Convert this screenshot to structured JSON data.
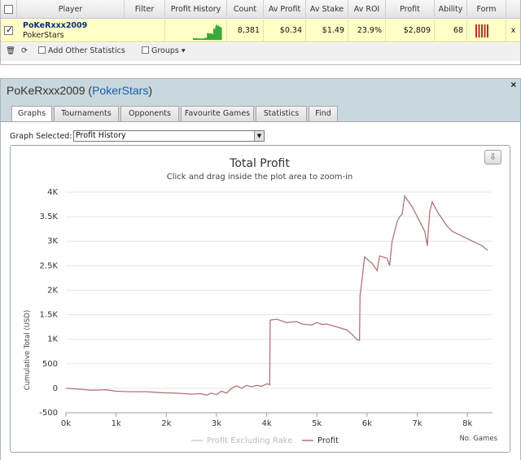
{
  "grid": {
    "columns": [
      "Player",
      "Filter",
      "Profit History",
      "Count",
      "Av Profit",
      "Av Stake",
      "Av ROI",
      "Profit",
      "Ability",
      "Form"
    ],
    "row": {
      "player_name": "PoKeRxxx2009",
      "site": "PokerStars",
      "count": "8,381",
      "av_profit": "$0.34",
      "av_stake": "$1.49",
      "av_roi": "23.9%",
      "profit": "$2,809",
      "ability": "68",
      "remove": "x"
    },
    "sparkline_color": "#3aa83a",
    "form_color": "#b03030",
    "toolbar": {
      "add_stats": "Add Other Statistics",
      "groups": "Groups"
    }
  },
  "panel": {
    "player_name": "PoKeRxxx2009",
    "site": "PokerStars",
    "close": "×",
    "tabs": [
      "Graphs",
      "Tournaments",
      "Opponents",
      "Favourite Games",
      "Statistics",
      "Find"
    ],
    "active_tab": 0,
    "graph_selected_label": "Graph Selected:",
    "graph_selected_value": "Profit History",
    "download_icon": "download-icon"
  },
  "chart_data": {
    "type": "line",
    "title": "Total Profit",
    "subtitle": "Click and drag inside the plot area to zoom-in",
    "xlabel": "No. Games",
    "ylabel": "Cumulative Total (USD)",
    "xlim": [
      0,
      8500
    ],
    "ylim": [
      -500,
      4000
    ],
    "x_ticks": [
      "0k",
      "1k",
      "2k",
      "3k",
      "4k",
      "5k",
      "6k",
      "7k",
      "8k"
    ],
    "y_ticks": [
      "-500",
      "0",
      "500",
      "1K",
      "1.5K",
      "2K",
      "2.5K",
      "3K",
      "3.5K",
      "4K"
    ],
    "legend": [
      "Profit Excluding Rake",
      "Profit"
    ],
    "legend_colors": [
      "#cccccc",
      "#b07575"
    ],
    "line_color": "#b07575",
    "series": [
      {
        "name": "Profit",
        "points": [
          [
            0,
            0
          ],
          [
            300,
            -20
          ],
          [
            500,
            -40
          ],
          [
            800,
            -30
          ],
          [
            1000,
            -60
          ],
          [
            1300,
            -70
          ],
          [
            1600,
            -70
          ],
          [
            1900,
            -90
          ],
          [
            2200,
            -100
          ],
          [
            2500,
            -120
          ],
          [
            2700,
            -110
          ],
          [
            2800,
            -140
          ],
          [
            2900,
            -100
          ],
          [
            3000,
            -130
          ],
          [
            3100,
            -60
          ],
          [
            3200,
            -100
          ],
          [
            3300,
            0
          ],
          [
            3400,
            50
          ],
          [
            3500,
            0
          ],
          [
            3600,
            60
          ],
          [
            3700,
            30
          ],
          [
            3800,
            60
          ],
          [
            3900,
            40
          ],
          [
            4000,
            90
          ],
          [
            4050,
            80
          ],
          [
            4060,
            60
          ],
          [
            4070,
            1390
          ],
          [
            4200,
            1410
          ],
          [
            4400,
            1340
          ],
          [
            4600,
            1360
          ],
          [
            4700,
            1310
          ],
          [
            4900,
            1290
          ],
          [
            5000,
            1340
          ],
          [
            5100,
            1300
          ],
          [
            5200,
            1310
          ],
          [
            5400,
            1250
          ],
          [
            5600,
            1190
          ],
          [
            5700,
            1100
          ],
          [
            5800,
            990
          ],
          [
            5850,
            980
          ],
          [
            5860,
            1900
          ],
          [
            5900,
            2200
          ],
          [
            5950,
            2680
          ],
          [
            6100,
            2550
          ],
          [
            6200,
            2400
          ],
          [
            6250,
            2700
          ],
          [
            6400,
            2650
          ],
          [
            6450,
            2500
          ],
          [
            6500,
            3000
          ],
          [
            6550,
            3200
          ],
          [
            6600,
            3400
          ],
          [
            6650,
            3500
          ],
          [
            6700,
            3550
          ],
          [
            6750,
            3920
          ],
          [
            6900,
            3700
          ],
          [
            7000,
            3500
          ],
          [
            7100,
            3300
          ],
          [
            7150,
            3200
          ],
          [
            7200,
            2900
          ],
          [
            7250,
            3600
          ],
          [
            7300,
            3800
          ],
          [
            7400,
            3600
          ],
          [
            7500,
            3450
          ],
          [
            7600,
            3300
          ],
          [
            7700,
            3200
          ],
          [
            7800,
            3150
          ],
          [
            7900,
            3100
          ],
          [
            8000,
            3050
          ],
          [
            8100,
            3000
          ],
          [
            8200,
            2950
          ],
          [
            8300,
            2900
          ],
          [
            8400,
            2810
          ]
        ]
      }
    ]
  }
}
